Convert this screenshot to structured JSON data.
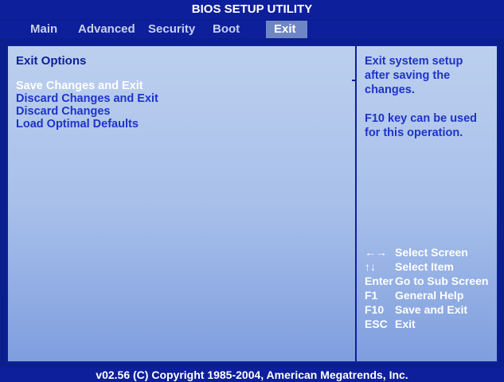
{
  "title": "BIOS SETUP UTILITY",
  "menu": {
    "items": [
      {
        "label": "Main"
      },
      {
        "label": "Advanced"
      },
      {
        "label": "Security"
      },
      {
        "label": "Boot"
      },
      {
        "label": "Exit",
        "active": true
      }
    ]
  },
  "main": {
    "section_title": "Exit Options",
    "options": [
      {
        "label": "Save Changes and Exit",
        "selected": true
      },
      {
        "label": "Discard Changes and Exit"
      },
      {
        "label": "Discard Changes"
      },
      {
        "label": "Load Optimal Defaults"
      }
    ]
  },
  "help": {
    "description": "Exit system setup\nafter saving the\nchanges.",
    "note": "F10 key can be used\nfor this operation.",
    "keys": [
      {
        "key": "←→",
        "desc": "Select Screen"
      },
      {
        "key": "↑↓",
        "desc": "Select Item"
      },
      {
        "key": "Enter",
        "desc": "Go to Sub Screen"
      },
      {
        "key": "F1",
        "desc": "General Help"
      },
      {
        "key": "F10",
        "desc": "Save and Exit"
      },
      {
        "key": "ESC",
        "desc": "Exit"
      }
    ]
  },
  "footer": "v02.56 (C) Copyright  1985-2004, American Megatrends, Inc.",
  "colors": {
    "background": "#0a1f8c",
    "panel_light": "#bccfee",
    "panel_dark": "#7f9ede",
    "option_text": "#1e33c9",
    "selected_text": "#ffffff",
    "active_tab": "#6f86c5"
  }
}
